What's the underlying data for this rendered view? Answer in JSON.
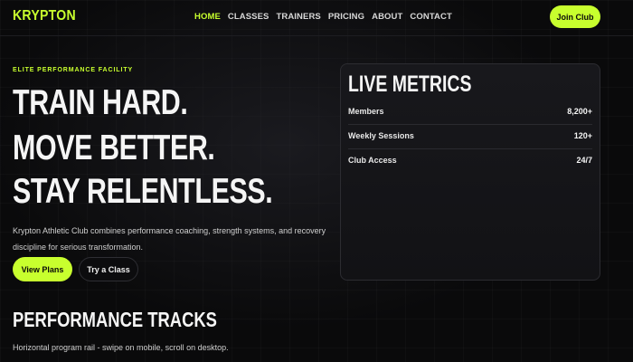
{
  "header": {
    "logo": "KRYPTON",
    "nav": [
      "HOME",
      "CLASSES",
      "TRAINERS",
      "PRICING",
      "ABOUT",
      "CONTACT"
    ],
    "active_nav": "HOME",
    "join_label": "Join Club"
  },
  "hero": {
    "eyebrow": "ELITE PERFORMANCE FACILITY",
    "lines": [
      "TRAIN HARD.",
      "MOVE BETTER.",
      "STAY RELENTLESS."
    ],
    "description": "Krypton Athletic Club combines performance coaching, strength systems, and recovery discipline for serious transformation.",
    "primary_cta": "View Plans",
    "secondary_cta": "Try a Class"
  },
  "metrics": {
    "title": "LIVE METRICS",
    "rows": [
      {
        "label": "Members",
        "value": "8,200+"
      },
      {
        "label": "Weekly Sessions",
        "value": "120+"
      },
      {
        "label": "Club Access",
        "value": "24/7"
      }
    ]
  },
  "tracks": {
    "title": "PERFORMANCE TRACKS",
    "description": "Horizontal program rail - swipe on mobile, scroll on desktop."
  },
  "colors": {
    "accent": "#c8ff2e",
    "background": "#0a0a0b",
    "card": "#16161a"
  }
}
